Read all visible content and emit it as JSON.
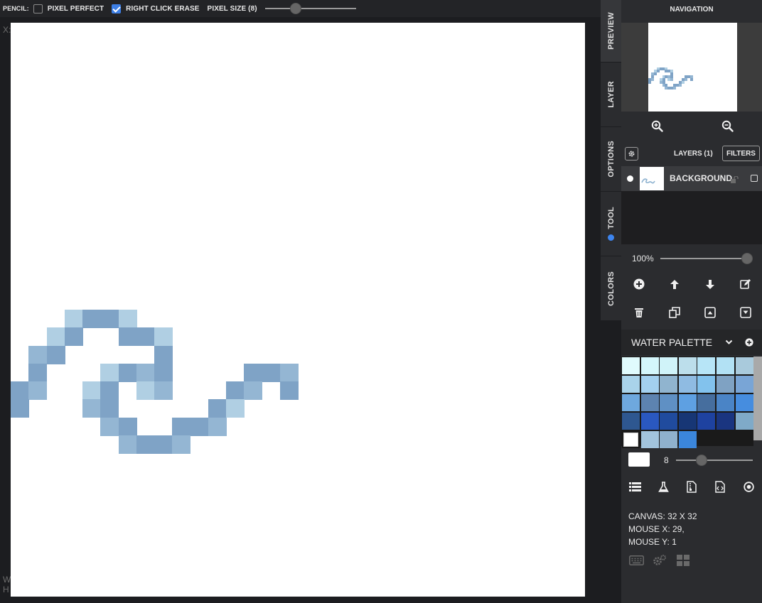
{
  "toolbar": {
    "tool_name": "PENCIL:",
    "pixel_perfect_label": "PIXEL PERFECT",
    "pixel_perfect_checked": false,
    "right_click_erase_label": "RIGHT CLICK ERASE",
    "right_click_erase_checked": true,
    "pixel_size_label": "PIXEL SIZE (8)",
    "pixel_size_value": 8
  },
  "workspace": {
    "coord_label": "X:",
    "width_label": "W",
    "height_label": "H"
  },
  "tabs": {
    "preview": "PREVIEW",
    "layer": "LAYER",
    "options": "OPTIONS",
    "tool": "TOOL",
    "colors": "COLORS"
  },
  "navigation": {
    "title": "NAVIGATION"
  },
  "layers": {
    "title": "LAYERS (1)",
    "filters_label": "FILTERS",
    "items": [
      {
        "name": "BACKGROUND",
        "visible": true,
        "locked": false,
        "checked": false
      }
    ],
    "opacity": "100%"
  },
  "palette": {
    "name": "WATER PALETTE",
    "rows": [
      [
        "#e0fbfd",
        "#d4f6fb",
        "#d0f3f9",
        "#bcdeeb",
        "#b7e5f7",
        "#b2e1f4",
        "#a9cadc"
      ],
      [
        "#a9d3ea",
        "#a3d0ef",
        "#90b4cf",
        "#8fbbe2",
        "#82c2ed",
        "#7fa2c3",
        "#79a5d6"
      ],
      [
        "#6ea8de",
        "#5d83b0",
        "#5f90c4",
        "#5ea0e2",
        "#466e9e",
        "#4a84c6",
        "#468ddf"
      ],
      [
        "#2e5790",
        "#2a58c0",
        "#204b9e",
        "#173675",
        "#1e42a0",
        "#1a3580",
        "#7faac8"
      ],
      [
        "#ffffff",
        "#a2c4dd",
        "#8fb1cd",
        "#3b86db"
      ]
    ],
    "selected": "#ffffff"
  },
  "brush": {
    "color": "#ffffff",
    "size": "8"
  },
  "info": {
    "canvas": "CANVAS: 32 X 32",
    "mouse_x": "MOUSE X: 29,",
    "mouse_y": "MOUSE Y: 1"
  },
  "pixel_art": {
    "grid_size": 32,
    "pixels": [
      {
        "c": 3,
        "r": 16,
        "color": "#b0cfe3"
      },
      {
        "c": 4,
        "r": 16,
        "color": "#7fa3c6"
      },
      {
        "c": 5,
        "r": 16,
        "color": "#7fa3c6"
      },
      {
        "c": 6,
        "r": 16,
        "color": "#b0cfe3"
      },
      {
        "c": 2,
        "r": 17,
        "color": "#b0cfe3"
      },
      {
        "c": 3,
        "r": 17,
        "color": "#7fa3c6"
      },
      {
        "c": 6,
        "r": 17,
        "color": "#7fa3c6"
      },
      {
        "c": 7,
        "r": 17,
        "color": "#7fa3c6"
      },
      {
        "c": 8,
        "r": 17,
        "color": "#b0cfe3"
      },
      {
        "c": 1,
        "r": 18,
        "color": "#94b6d3"
      },
      {
        "c": 2,
        "r": 18,
        "color": "#7fa3c6"
      },
      {
        "c": 8,
        "r": 18,
        "color": "#7fa3c6"
      },
      {
        "c": 1,
        "r": 19,
        "color": "#7fa3c6"
      },
      {
        "c": 5,
        "r": 19,
        "color": "#b0cfe3"
      },
      {
        "c": 6,
        "r": 19,
        "color": "#7fa3c6"
      },
      {
        "c": 7,
        "r": 19,
        "color": "#94b6d3"
      },
      {
        "c": 8,
        "r": 19,
        "color": "#7fa3c6"
      },
      {
        "c": 13,
        "r": 19,
        "color": "#7fa3c6"
      },
      {
        "c": 14,
        "r": 19,
        "color": "#7fa3c6"
      },
      {
        "c": 15,
        "r": 19,
        "color": "#94b6d3"
      },
      {
        "c": 0,
        "r": 20,
        "color": "#7fa3c6"
      },
      {
        "c": 1,
        "r": 20,
        "color": "#94b6d3"
      },
      {
        "c": 4,
        "r": 20,
        "color": "#b0cfe3"
      },
      {
        "c": 5,
        "r": 20,
        "color": "#7fa3c6"
      },
      {
        "c": 7,
        "r": 20,
        "color": "#b0cfe3"
      },
      {
        "c": 8,
        "r": 20,
        "color": "#94b6d3"
      },
      {
        "c": 12,
        "r": 20,
        "color": "#7fa3c6"
      },
      {
        "c": 13,
        "r": 20,
        "color": "#94b6d3"
      },
      {
        "c": 15,
        "r": 20,
        "color": "#7fa3c6"
      },
      {
        "c": 0,
        "r": 21,
        "color": "#7fa3c6"
      },
      {
        "c": 4,
        "r": 21,
        "color": "#94b6d3"
      },
      {
        "c": 5,
        "r": 21,
        "color": "#7fa3c6"
      },
      {
        "c": 11,
        "r": 21,
        "color": "#7fa3c6"
      },
      {
        "c": 12,
        "r": 21,
        "color": "#b0cfe3"
      },
      {
        "c": 5,
        "r": 22,
        "color": "#94b6d3"
      },
      {
        "c": 6,
        "r": 22,
        "color": "#7fa3c6"
      },
      {
        "c": 9,
        "r": 22,
        "color": "#7fa3c6"
      },
      {
        "c": 10,
        "r": 22,
        "color": "#7fa3c6"
      },
      {
        "c": 11,
        "r": 22,
        "color": "#94b6d3"
      },
      {
        "c": 6,
        "r": 23,
        "color": "#94b6d3"
      },
      {
        "c": 7,
        "r": 23,
        "color": "#7fa3c6"
      },
      {
        "c": 8,
        "r": 23,
        "color": "#7fa3c6"
      },
      {
        "c": 9,
        "r": 23,
        "color": "#94b6d3"
      }
    ]
  }
}
